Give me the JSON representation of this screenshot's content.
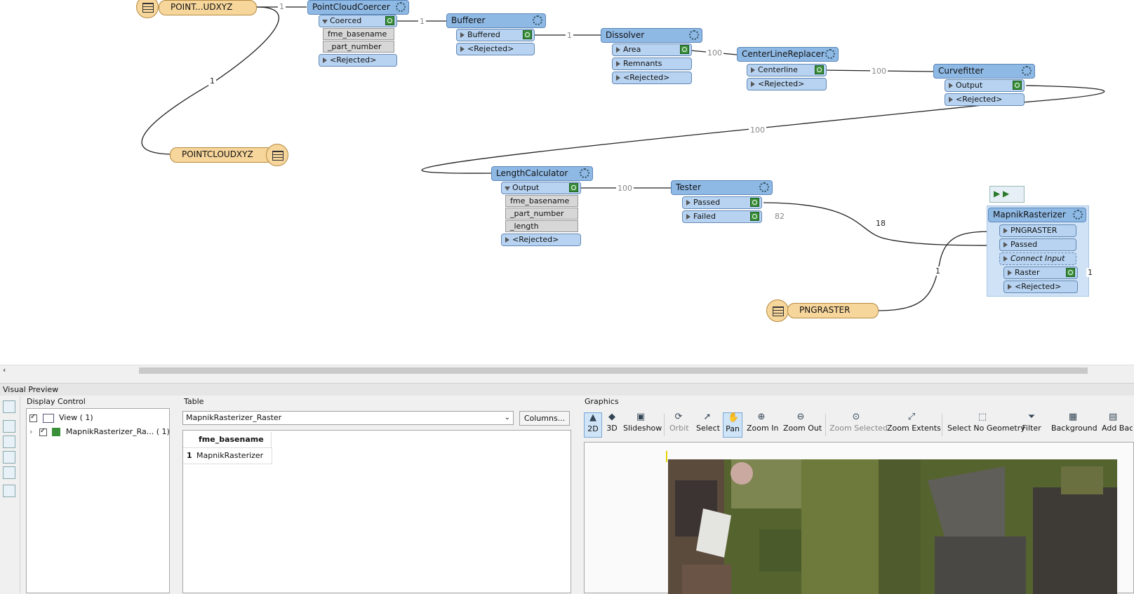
{
  "canvas": {
    "readers": {
      "pointcloud_top": "POINT...UDXYZ",
      "pointcloud_bottom": "POINTCLOUDXYZ",
      "pngraster": "PNGRASTER"
    },
    "transformers": {
      "pointcloudcoercer": {
        "title": "PointCloudCoercer",
        "ports": [
          "Coerced",
          "<Rejected>"
        ],
        "attrs": [
          "fme_basename",
          "_part_number"
        ]
      },
      "bufferer": {
        "title": "Bufferer",
        "ports": [
          "Buffered",
          "<Rejected>"
        ]
      },
      "dissolver": {
        "title": "Dissolver",
        "ports": [
          "Area",
          "Remnants",
          "<Rejected>"
        ]
      },
      "centerlinereplacer": {
        "title": "CenterLineReplacer",
        "ports": [
          "Centerline",
          "<Rejected>"
        ]
      },
      "curvefitter": {
        "title": "Curvefitter",
        "ports": [
          "Output",
          "<Rejected>"
        ]
      },
      "lengthcalculator": {
        "title": "LengthCalculator",
        "ports": [
          "Output",
          "<Rejected>"
        ],
        "attrs": [
          "fme_basename",
          "_part_number",
          "_length"
        ]
      },
      "tester": {
        "title": "Tester",
        "ports": [
          "Passed",
          "Failed"
        ]
      },
      "mapnikrasterizer": {
        "title": "MapnikRasterizer",
        "inputs": [
          "PNGRASTER",
          "Passed",
          "Connect Input"
        ],
        "ports": [
          "Raster",
          "<Rejected>"
        ]
      }
    },
    "wire_labels": {
      "reader_to_bottom": "1",
      "reader_to_coercer": "1",
      "coercer_to_bufferer": "1",
      "bufferer_to_dissolver": "1",
      "dissolver_to_clr": "100",
      "clr_to_curvefitter": "100",
      "curvefitter_to_length": "100",
      "length_to_tester": "100",
      "tester_passed": "18",
      "tester_failed": "82",
      "pngraster": "1",
      "raster_out": "1"
    }
  },
  "visual_preview": {
    "title": "Visual Preview",
    "display_control": {
      "label": "Display Control",
      "view_label": "View",
      "view_count": "( 1)",
      "layer_label": "MapnikRasterizer_Ra...",
      "layer_count": "( 1)"
    },
    "table": {
      "label": "Table",
      "selected": "MapnikRasterizer_Raster",
      "columns_button": "Columns...",
      "header": "fme_basename",
      "rows": [
        {
          "num": "1",
          "value": "MapnikRasterizer"
        }
      ]
    },
    "graphics": {
      "label": "Graphics",
      "tools": [
        "2D",
        "3D",
        "Slideshow",
        "Orbit",
        "Select",
        "Pan",
        "Zoom In",
        "Zoom Out",
        "Zoom Selected",
        "Zoom Extents",
        "Select No Geometry",
        "Filter",
        "Background",
        "Add Bac"
      ]
    }
  }
}
